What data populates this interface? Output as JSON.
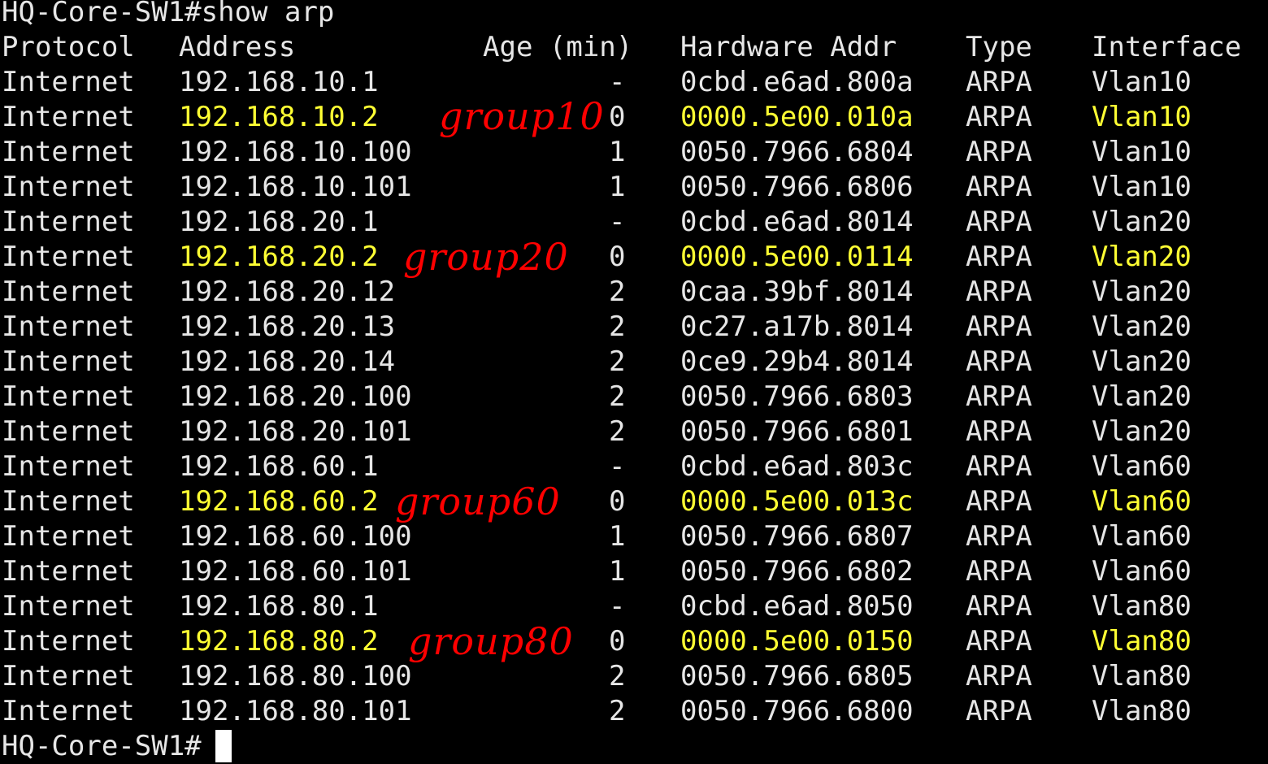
{
  "terminal": {
    "command_line": "HQ-Core-SW1#show arp",
    "prompt": "HQ-Core-SW1#",
    "colors": {
      "background": "#000000",
      "text": "#e6e6e6",
      "highlight": "#ffff33",
      "annotation": "#ff0000"
    },
    "headers": {
      "protocol": "Protocol",
      "address": "Address",
      "age": "Age (min)",
      "hardware": "Hardware Addr",
      "type": "Type",
      "interface": "Interface"
    },
    "rows": [
      {
        "protocol": "Internet",
        "address": "192.168.10.1",
        "age": "-",
        "hardware": "0cbd.e6ad.800a",
        "type": "ARPA",
        "interface": "Vlan10"
      },
      {
        "protocol": "Internet",
        "address": "192.168.10.2",
        "age": "0",
        "hardware": "0000.5e00.010a",
        "type": "ARPA",
        "interface": "Vlan10"
      },
      {
        "protocol": "Internet",
        "address": "192.168.10.100",
        "age": "1",
        "hardware": "0050.7966.6804",
        "type": "ARPA",
        "interface": "Vlan10"
      },
      {
        "protocol": "Internet",
        "address": "192.168.10.101",
        "age": "1",
        "hardware": "0050.7966.6806",
        "type": "ARPA",
        "interface": "Vlan10"
      },
      {
        "protocol": "Internet",
        "address": "192.168.20.1",
        "age": "-",
        "hardware": "0cbd.e6ad.8014",
        "type": "ARPA",
        "interface": "Vlan20"
      },
      {
        "protocol": "Internet",
        "address": "192.168.20.2",
        "age": "0",
        "hardware": "0000.5e00.0114",
        "type": "ARPA",
        "interface": "Vlan20"
      },
      {
        "protocol": "Internet",
        "address": "192.168.20.12",
        "age": "2",
        "hardware": "0caa.39bf.8014",
        "type": "ARPA",
        "interface": "Vlan20"
      },
      {
        "protocol": "Internet",
        "address": "192.168.20.13",
        "age": "2",
        "hardware": "0c27.a17b.8014",
        "type": "ARPA",
        "interface": "Vlan20"
      },
      {
        "protocol": "Internet",
        "address": "192.168.20.14",
        "age": "2",
        "hardware": "0ce9.29b4.8014",
        "type": "ARPA",
        "interface": "Vlan20"
      },
      {
        "protocol": "Internet",
        "address": "192.168.20.100",
        "age": "2",
        "hardware": "0050.7966.6803",
        "type": "ARPA",
        "interface": "Vlan20"
      },
      {
        "protocol": "Internet",
        "address": "192.168.20.101",
        "age": "2",
        "hardware": "0050.7966.6801",
        "type": "ARPA",
        "interface": "Vlan20"
      },
      {
        "protocol": "Internet",
        "address": "192.168.60.1",
        "age": "-",
        "hardware": "0cbd.e6ad.803c",
        "type": "ARPA",
        "interface": "Vlan60"
      },
      {
        "protocol": "Internet",
        "address": "192.168.60.2",
        "age": "0",
        "hardware": "0000.5e00.013c",
        "type": "ARPA",
        "interface": "Vlan60"
      },
      {
        "protocol": "Internet",
        "address": "192.168.60.100",
        "age": "1",
        "hardware": "0050.7966.6807",
        "type": "ARPA",
        "interface": "Vlan60"
      },
      {
        "protocol": "Internet",
        "address": "192.168.60.101",
        "age": "1",
        "hardware": "0050.7966.6802",
        "type": "ARPA",
        "interface": "Vlan60"
      },
      {
        "protocol": "Internet",
        "address": "192.168.80.1",
        "age": "-",
        "hardware": "0cbd.e6ad.8050",
        "type": "ARPA",
        "interface": "Vlan80"
      },
      {
        "protocol": "Internet",
        "address": "192.168.80.2",
        "age": "0",
        "hardware": "0000.5e00.0150",
        "type": "ARPA",
        "interface": "Vlan80"
      },
      {
        "protocol": "Internet",
        "address": "192.168.80.100",
        "age": "2",
        "hardware": "0050.7966.6805",
        "type": "ARPA",
        "interface": "Vlan80"
      },
      {
        "protocol": "Internet",
        "address": "192.168.80.101",
        "age": "2",
        "hardware": "0050.7966.6800",
        "type": "ARPA",
        "interface": "Vlan80"
      }
    ],
    "annotations": [
      "group10",
      "group20",
      "group60",
      "group80"
    ]
  }
}
